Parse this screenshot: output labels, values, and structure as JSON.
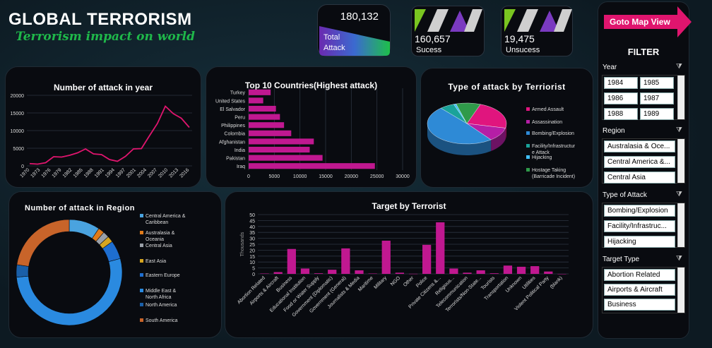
{
  "header": {
    "title": "GLOBAL TERRORISM",
    "subtitle": "Terrorism impact on world"
  },
  "kpis": {
    "total": {
      "value": "180,132",
      "label1": "Total",
      "label2": "Attack"
    },
    "success": {
      "value": "160,657",
      "label": "Sucess"
    },
    "unsuccess": {
      "value": "19,475",
      "label": "Unsucess"
    }
  },
  "map_button": "Goto Map View",
  "filter": {
    "title": "FILTER",
    "year": {
      "label": "Year",
      "items": [
        "1984",
        "1985",
        "1986",
        "1987",
        "1988",
        "1989"
      ]
    },
    "region": {
      "label": "Region",
      "items": [
        "Australasia & Oce...",
        "Central America &...",
        "Central Asia"
      ]
    },
    "attack_type": {
      "label": "Type of Attack",
      "items": [
        "Bombing/Explosion",
        "Facility/Infrastruc...",
        "Hijacking"
      ]
    },
    "target_type": {
      "label": "Target Type",
      "items": [
        "Abortion Related",
        "Airports & Aircraft",
        "Business"
      ]
    }
  },
  "chart_data": [
    {
      "type": "line",
      "title": "Number of attack in year",
      "x": [
        "1970",
        "1973",
        "1976",
        "1979",
        "1982",
        "1985",
        "1988",
        "1991",
        "1994",
        "1997",
        "2000",
        "2003",
        "2006",
        "2009",
        "2010",
        "2012",
        "2013",
        "2014",
        "2015",
        "2016",
        "2017"
      ],
      "values": [
        650,
        500,
        900,
        2600,
        2500,
        3000,
        3700,
        4800,
        3400,
        3200,
        1800,
        1300,
        2700,
        4800,
        4900,
        8500,
        12000,
        16900,
        14800,
        13500,
        10900
      ],
      "xticks": [
        "1970",
        "1973",
        "1976",
        "1979",
        "1982",
        "1985",
        "1988",
        "1991",
        "1994",
        "1997",
        "2001",
        "2004",
        "2007",
        "2010",
        "2013",
        "2016"
      ],
      "yticks": [
        "0",
        "5000",
        "10000",
        "15000",
        "20000"
      ],
      "ylim": [
        0,
        20000
      ]
    },
    {
      "type": "bar",
      "title": "Top 10 Countries(Highest attack)",
      "categories": [
        "Turkey",
        "United States",
        "El Salvador",
        "Peru",
        "Philippines",
        "Colombia",
        "Afghanistan",
        "India",
        "Pakistan",
        "Iraq"
      ],
      "values": [
        4290,
        2840,
        5320,
        6100,
        6900,
        8300,
        12700,
        11900,
        14400,
        24600
      ],
      "xticks": [
        "0",
        "5000",
        "10000",
        "15000",
        "20000",
        "25000",
        "30000"
      ],
      "xlim": [
        0,
        30000
      ]
    },
    {
      "type": "pie",
      "title": "Type of attack by Terriorist",
      "labels": [
        "Armed Assault",
        "Assassination",
        "Bombing/Explosion",
        "Facility/Infrastructure Attack",
        "Hijacking",
        "Hostage Taking (Barricade Incident)"
      ],
      "legend_text": [
        "Armed Assault",
        "Assassination",
        "Bombing/Explosion",
        "Facility/Infrastructur e Attack",
        "Hijacking",
        "Hostage Taking (Barricade Incident)"
      ],
      "values": [
        23,
        11,
        49,
        6,
        1,
        10
      ],
      "colors": [
        "#e0157e",
        "#b51ea6",
        "#2e8ad6",
        "#1aa39a",
        "#40c0ff",
        "#2f9a4a"
      ]
    },
    {
      "type": "pie",
      "title": "Number of attack in Region",
      "labels": [
        "Central America & Caribbean",
        "Australasia & Oceania",
        "Central Asia",
        "East Asia",
        "Eastern Europe",
        "Middle East & North Africa",
        "North America",
        "South America"
      ],
      "values": [
        5,
        1,
        1,
        1,
        3,
        28,
        2,
        12
      ],
      "colors": [
        "#4aa3df",
        "#e07b1a",
        "#9aa0a8",
        "#d6a520",
        "#1e6ed0",
        "#2a8ae0",
        "#1a5fa8",
        "#c8642a"
      ]
    },
    {
      "type": "bar",
      "title": "Target by Terrorist",
      "ylabel": "Thousands",
      "categories": [
        "Abortion Related",
        "Airports & Aircraft",
        "Business",
        "Educational Institution",
        "Food or Water Supply",
        "Government (Diplomatic)",
        "Government (General)",
        "Journalists & Media",
        "Maritime",
        "Military",
        "NGO",
        "Other",
        "Police",
        "Private Citizens &...",
        "Religious...",
        "Telecommunication",
        "Terrorists/Non-State...",
        "Tourists",
        "Transportation",
        "Unknown",
        "Utilities",
        "Violent Political Party",
        "(blank)"
      ],
      "values": [
        0.3,
        1.5,
        21,
        4.5,
        0.5,
        3.5,
        21.5,
        3,
        0.3,
        28,
        1,
        0.1,
        24.5,
        43.5,
        4.5,
        1,
        3,
        0.5,
        7,
        6,
        6.5,
        2,
        0
      ],
      "yticks": [
        "0",
        "5",
        "10",
        "15",
        "20",
        "25",
        "30",
        "35",
        "40",
        "45",
        "50"
      ],
      "ylim": [
        0,
        50
      ]
    }
  ]
}
